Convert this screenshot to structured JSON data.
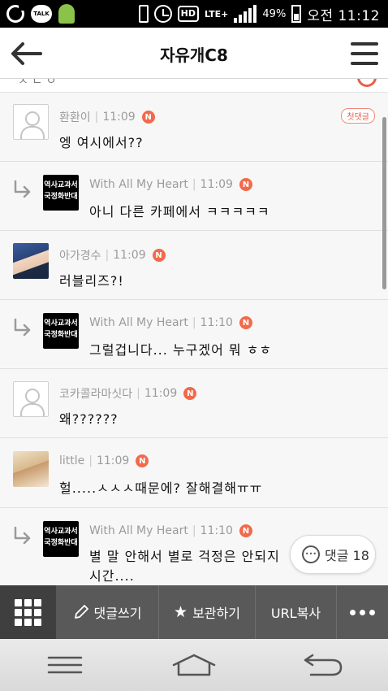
{
  "status_bar": {
    "talk_label": "TALK",
    "network": "LTE+",
    "battery_pct": "49%",
    "time": "오전 11:12",
    "hd_label": "HD"
  },
  "header": {
    "title": "자유개C8"
  },
  "partial_row_text": "ㅈ ㄴ ㅇ",
  "comments": [
    {
      "author": "환환이",
      "time": "11:09",
      "badge": "N",
      "text": "엥 여시에서??",
      "avatar": "default",
      "is_reply": false,
      "tag": "첫댓글"
    },
    {
      "author": "With All My Heart",
      "time": "11:09",
      "badge": "N",
      "text": "아니 다른 카페에서 ㅋㅋㅋㅋㅋ",
      "avatar": "badge",
      "avatar_text": "역사교과서 국정화반대",
      "is_reply": true
    },
    {
      "author": "아가경수",
      "time": "11:09",
      "badge": "N",
      "text": "러블리즈?!",
      "avatar": "photo",
      "is_reply": false
    },
    {
      "author": "With All My Heart",
      "time": "11:10",
      "badge": "N",
      "text": "그럴겁니다... 누구겠어 뭐 ㅎㅎ",
      "avatar": "badge",
      "avatar_text": "역사교과서 국정화반대",
      "is_reply": true
    },
    {
      "author": "코카콜라마싯다",
      "time": "11:09",
      "badge": "N",
      "text": "왜??????",
      "avatar": "default",
      "is_reply": false
    },
    {
      "author": "little",
      "time": "11:09",
      "badge": "N",
      "text": "헐.....ㅅㅅㅅ때문에? 잘해결해ㅠㅠ",
      "avatar": "photo",
      "is_reply": false
    },
    {
      "author": "With All My Heart",
      "time": "11:10",
      "badge": "N",
      "text": "별 말 안해서 별로 걱정은 안되지",
      "text_line2": "시간....",
      "avatar": "badge",
      "avatar_text": "역사교과서 국정화반대",
      "is_reply": true
    }
  ],
  "comment_count_button": {
    "label": "댓글 18"
  },
  "toolbar": {
    "write_label": "댓글쓰기",
    "save_label": "보관하기",
    "url_label": "URL복사"
  }
}
